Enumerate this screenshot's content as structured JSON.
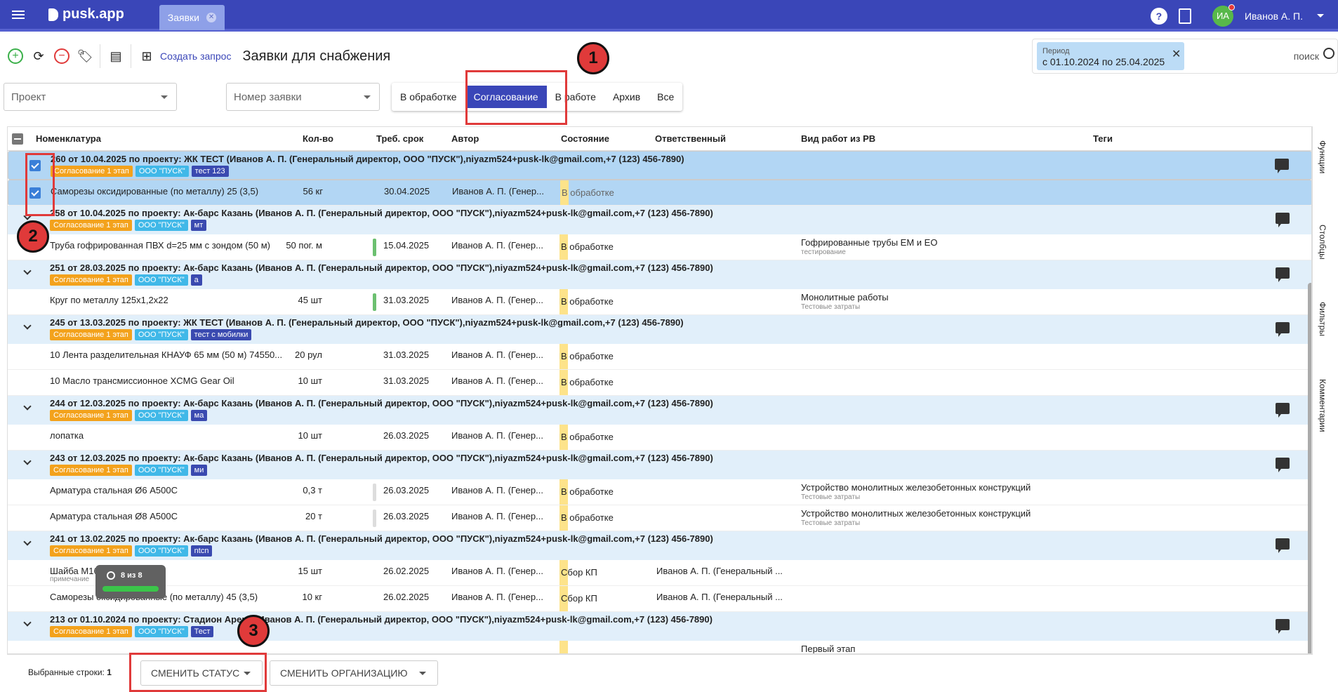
{
  "app": {
    "name": "pusk.app",
    "tab": "Заявки",
    "user_initials": "ИА",
    "user_name": "Иванов А. П."
  },
  "toolbar": {
    "create_label": "Создать запрос",
    "page_title": "Заявки для снабжения"
  },
  "period": {
    "label": "Период",
    "value": "с 01.10.2024 по 25.04.2025",
    "search_placeholder": "поиск"
  },
  "filters": {
    "project_placeholder": "Проект",
    "number_placeholder": "Номер заявки"
  },
  "segments": [
    "В обработке",
    "Согласование",
    "В работе",
    "Архив",
    "Все"
  ],
  "active_segment": "Согласование",
  "columns": [
    "Номенклатура",
    "Кол-во",
    "Треб. срок",
    "Автор",
    "Состояние",
    "Ответственный",
    "Вид работ из РВ",
    "Теги"
  ],
  "groups": [
    {
      "title": "260 от 10.04.2025 по проекту: ЖК ТЕСТ (Иванов А. П. (Генеральный директор, ООО \"ПУСК\"),niyazm524+pusk-lk@gmail.com,+7 (123) 456-7890)",
      "chips": [
        "Согласование 1 этап",
        "ООО \"ПУСК\"",
        "тест 123"
      ],
      "selected": true,
      "items": [
        {
          "name": "Саморезы оксидированные (по металлу) 25 (3,5)",
          "qty": "56 кг",
          "date": "30.04.2025",
          "author": "Иванов А. П. (Генер...",
          "state": "В обработке",
          "resp": "",
          "work": "",
          "work_sub": "",
          "bar": "",
          "selected": true
        }
      ]
    },
    {
      "title": "258 от 10.04.2025 по проекту: Ак-барс Казань (Иванов А. П. (Генеральный директор, ООО \"ПУСК\"),niyazm524+pusk-lk@gmail.com,+7 (123) 456-7890)",
      "chips": [
        "Согласование 1 этап",
        "ООО \"ПУСК\"",
        "мт"
      ],
      "items": [
        {
          "name": "Труба гофрированная ПВХ d=25 мм с зондом (50 м)",
          "qty": "50 пог. м",
          "date": "15.04.2025",
          "author": "Иванов А. П. (Генер...",
          "state": "В обработке",
          "resp": "",
          "work": "Гофрированные трубы ЕМ и ЕО",
          "work_sub": "тестирование",
          "bar": "#6cc070"
        }
      ]
    },
    {
      "title": "251 от 28.03.2025 по проекту: Ак-барс Казань (Иванов А. П. (Генеральный директор, ООО \"ПУСК\"),niyazm524+pusk-lk@gmail.com,+7 (123) 456-7890)",
      "chips": [
        "Согласование 1 этап",
        "ООО \"ПУСК\"",
        "а"
      ],
      "items": [
        {
          "name": "Круг по металлу 125х1,2х22",
          "qty": "45 шт",
          "date": "31.03.2025",
          "author": "Иванов А. П. (Генер...",
          "state": "В обработке",
          "resp": "",
          "work": "Монолитные работы",
          "work_sub": "Тестовые затраты",
          "bar": "#6cc070"
        }
      ]
    },
    {
      "title": "245 от 13.03.2025 по проекту: ЖК ТЕСТ (Иванов А. П. (Генеральный директор, ООО \"ПУСК\"),niyazm524+pusk-lk@gmail.com,+7 (123) 456-7890)",
      "chips": [
        "Согласование 1 этап",
        "ООО \"ПУСК\"",
        "тест с мобилки"
      ],
      "items": [
        {
          "name": "10 Лента разделительная КНАУФ 65 мм (50 м) 74550...",
          "qty": "20 рул",
          "date": "31.03.2025",
          "author": "Иванов А. П. (Генер...",
          "state": "В обработке",
          "resp": "",
          "work": "",
          "work_sub": "",
          "bar": ""
        },
        {
          "name": "10 Масло трансмиссионное XCMG Gear Oil",
          "qty": "10 шт",
          "date": "31.03.2025",
          "author": "Иванов А. П. (Генер...",
          "state": "В обработке",
          "resp": "",
          "work": "",
          "work_sub": "",
          "bar": ""
        }
      ]
    },
    {
      "title": "244 от 12.03.2025 по проекту: Ак-барс Казань (Иванов А. П. (Генеральный директор, ООО \"ПУСК\"),niyazm524+pusk-lk@gmail.com,+7 (123) 456-7890)",
      "chips": [
        "Согласование 1 этап",
        "ООО \"ПУСК\"",
        "ма"
      ],
      "items": [
        {
          "name": "лопатка",
          "qty": "10 шт",
          "date": "26.03.2025",
          "author": "Иванов А. П. (Генер...",
          "state": "В обработке",
          "resp": "",
          "work": "",
          "work_sub": "",
          "bar": ""
        }
      ]
    },
    {
      "title": "243 от 12.03.2025 по проекту: Ак-барс Казань (Иванов А. П. (Генеральный директор, ООО \"ПУСК\"),niyazm524+pusk-lk@gmail.com,+7 (123) 456-7890)",
      "chips": [
        "Согласование 1 этап",
        "ООО \"ПУСК\"",
        "ми"
      ],
      "items": [
        {
          "name": "Арматура стальная Ø6 А500С",
          "qty": "0,3 т",
          "date": "26.03.2025",
          "author": "Иванов А. П. (Генер...",
          "state": "В обработке",
          "resp": "",
          "work": "Устройство монолитных железобетонных конструкций",
          "work_sub": "Тестовые затраты",
          "bar": "#dddddd"
        },
        {
          "name": "Арматура стальная Ø8 А500С",
          "qty": "20 т",
          "date": "26.03.2025",
          "author": "Иванов А. П. (Генер...",
          "state": "В обработке",
          "resp": "",
          "work": "Устройство монолитных железобетонных конструкций",
          "work_sub": "Тестовые затраты",
          "bar": "#dddddd"
        }
      ]
    },
    {
      "title": "241 от 13.02.2025 по проекту: Ак-барс Казань (Иванов А. П. (Генеральный директор, ООО \"ПУСК\"),niyazm524+pusk-lk@gmail.com,+7 (123) 456-7890)",
      "chips": [
        "Согласование 1 этап",
        "ООО \"ПУСК\"",
        "ntcn"
      ],
      "items": [
        {
          "name": "Шайба М16",
          "name_sub": "примечание",
          "qty": "15 шт",
          "date": "26.02.2025",
          "author": "Иванов А. П. (Генер...",
          "state": "Сбор КП",
          "resp": "Иванов А. П. (Генеральный ...",
          "work": "",
          "work_sub": "",
          "bar": ""
        },
        {
          "name": "Саморезы оксидированные (по металлу) 45 (3,5)",
          "qty": "10 кг",
          "date": "26.02.2025",
          "author": "Иванов А. П. (Генер...",
          "state": "Сбор КП",
          "resp": "Иванов А. П. (Генеральный ...",
          "work": "",
          "work_sub": "",
          "bar": ""
        }
      ]
    },
    {
      "title": "213 от 01.10.2024 по проекту: Стадион Арена (Иванов А. П. (Генеральный директор, ООО \"ПУСК\"),niyazm524+pusk-lk@gmail.com,+7 (123) 456-7890)",
      "chips": [
        "Согласование 1 этап",
        "ООО \"ПУСК\"",
        "Тест"
      ],
      "items": [
        {
          "name": "",
          "qty": "",
          "date": "",
          "author": "",
          "state": "",
          "resp": "",
          "work": "Первый этап",
          "work_sub": "",
          "bar": ""
        }
      ]
    }
  ],
  "sidebar": [
    "Функции",
    "Столбцы",
    "Фильтры",
    "Комментарии"
  ],
  "bottom": {
    "selected_label": "Выбранные строки:",
    "selected_count": "1",
    "change_status": "СМЕНИТЬ СТАТУС",
    "change_org": "СМЕНИТЬ ОРГАНИЗАЦИЮ"
  },
  "toast": {
    "text": "8 из 8",
    "progress": 1.0
  },
  "callouts": [
    "1",
    "2",
    "3"
  ],
  "colors": {
    "primary": "#3a46b8",
    "group_bg": "#e1effa",
    "selected_bg": "#b2d6f4",
    "chip_orange": "#f3a21c",
    "chip_cyan": "#40b8e8",
    "chip_blue": "#3a4ab0",
    "state_bg": "#fde38a",
    "annotation": "#e03a3a"
  }
}
